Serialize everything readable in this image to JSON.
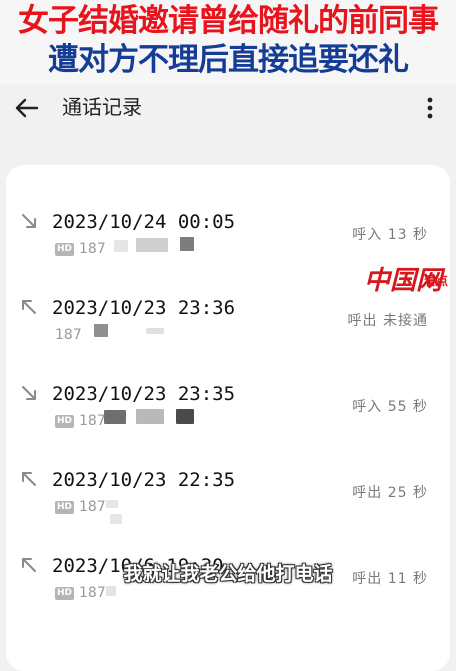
{
  "headline": {
    "line1": "女子结婚邀请曾给随礼的前同事",
    "line2": "遭对方不理后直接追要还礼",
    "line1_color": "#e8141d",
    "line2_color": "#153d96"
  },
  "appbar": {
    "back_icon": "back-arrow-icon",
    "title": "通话记录",
    "more_icon": "more-vertical-icon"
  },
  "calls": [
    {
      "datetime": "2023/10/24 00:05",
      "direction": "incoming",
      "sim": "HD",
      "number": "187",
      "status": "呼入 13 秒"
    },
    {
      "datetime": "2023/10/23 23:36",
      "direction": "outgoing",
      "sim": "",
      "number": "187",
      "status": "呼出 未接通"
    },
    {
      "datetime": "2023/10/23 23:35",
      "direction": "incoming",
      "sim": "HD",
      "number": "187",
      "status": "呼入 55 秒"
    },
    {
      "datetime": "2023/10/23 22:35",
      "direction": "outgoing",
      "sim": "HD",
      "number": "187",
      "status": "呼出 25 秒"
    },
    {
      "datetime": "2023/10/6 19:30",
      "direction": "outgoing",
      "sim": "HD",
      "number": "187",
      "status": "呼出 11 秒"
    }
  ],
  "watermark": {
    "logo": "中国网",
    "side_text": "看点",
    "color": "#d7171d"
  },
  "subtitle": "我就让我老公给他打电话"
}
